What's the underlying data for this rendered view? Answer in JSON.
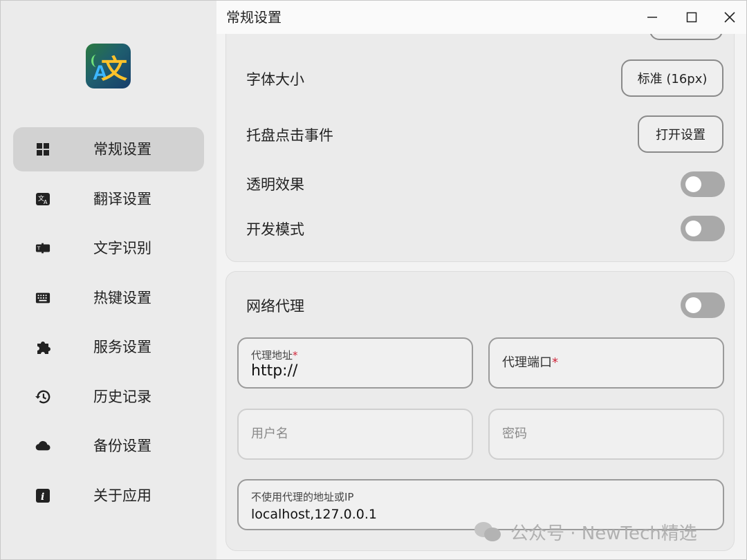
{
  "window": {
    "title": "常规设置",
    "controls": [
      "minimize-icon",
      "maximize-icon",
      "close-icon"
    ]
  },
  "sidebar": {
    "logo_icon": "translate-app-logo",
    "items": [
      {
        "label": "常规设置",
        "icon": "grid-icon",
        "active": true
      },
      {
        "label": "翻译设置",
        "icon": "translate-icon"
      },
      {
        "label": "文字识别",
        "icon": "ocr-icon"
      },
      {
        "label": "热键设置",
        "icon": "keyboard-icon"
      },
      {
        "label": "服务设置",
        "icon": "puzzle-icon"
      },
      {
        "label": "历史记录",
        "icon": "history-icon"
      },
      {
        "label": "备份设置",
        "icon": "cloud-icon"
      },
      {
        "label": "关于应用",
        "icon": "info-icon"
      }
    ]
  },
  "general": {
    "font_size_label": "字体大小",
    "font_size_value": "标准 (16px)",
    "tray_click_label": "托盘点击事件",
    "tray_click_value": "打开设置",
    "transparency_label": "透明效果",
    "transparency_on": false,
    "dev_mode_label": "开发模式",
    "dev_mode_on": false
  },
  "proxy": {
    "label": "网络代理",
    "enabled": false,
    "address_label": "代理地址",
    "address_value": "http://",
    "port_label": "代理端口",
    "required_mark": "*",
    "username_placeholder": "用户名",
    "password_placeholder": "密码",
    "no_proxy_label": "不使用代理的地址或IP",
    "no_proxy_value": "localhost,127.0.0.1"
  },
  "watermark": {
    "text": "公众号 · NewTech精选"
  }
}
